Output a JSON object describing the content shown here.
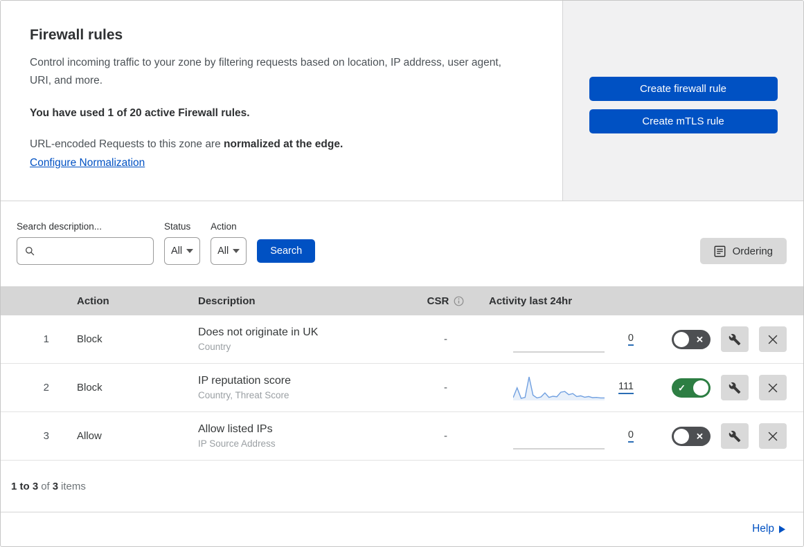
{
  "header": {
    "title": "Firewall rules",
    "description": "Control incoming traffic to your zone by filtering requests based on location, IP address, user agent, URI, and more.",
    "usage_text": "You have used 1 of 20 active Firewall rules.",
    "normalization_text": "URL-encoded Requests to this zone are",
    "normalization_bold": "normalized at the edge.",
    "normalization_link": "Configure Normalization",
    "buttons": {
      "create_firewall": "Create firewall rule",
      "create_mtls": "Create mTLS rule"
    }
  },
  "filters": {
    "search_label": "Search description...",
    "status_label": "Status",
    "status_value": "All",
    "action_label": "Action",
    "action_value": "All",
    "search_button": "Search",
    "ordering_button": "Ordering"
  },
  "table": {
    "columns": {
      "action": "Action",
      "description": "Description",
      "csr": "CSR",
      "activity": "Activity last 24hr"
    },
    "rules": [
      {
        "priority": "1",
        "action": "Block",
        "description": "Does not originate in UK",
        "fields": "Country",
        "csr": "-",
        "activity_count": "0",
        "enabled": false,
        "sparkline": []
      },
      {
        "priority": "2",
        "action": "Block",
        "description": "IP reputation score",
        "fields": "Country, Threat Score",
        "csr": "-",
        "activity_count": "111",
        "enabled": true,
        "sparkline": [
          9,
          52,
          6,
          10,
          100,
          20,
          8,
          12,
          30,
          10,
          15,
          13,
          33,
          36,
          22,
          27,
          14,
          17,
          11,
          14,
          9,
          10,
          8,
          8
        ]
      },
      {
        "priority": "3",
        "action": "Allow",
        "description": "Allow listed IPs",
        "fields": "IP Source Address",
        "csr": "-",
        "activity_count": "0",
        "enabled": false,
        "sparkline": []
      }
    ]
  },
  "footer": {
    "range_bold": "1 to 3",
    "of_text": "of",
    "total_bold": "3",
    "items_text": "items",
    "help_label": "Help"
  },
  "toggle_marks": {
    "on": "✓",
    "off": "✕"
  },
  "colors": {
    "accent_blue": "#0051c3",
    "toggle_on_green": "#2d7e43",
    "toggle_off_gray": "#4d4f52",
    "sparkline_blue": "#6f9fe0",
    "flat_line_gray": "#b9b9b9",
    "table_header_bg": "#d6d6d6",
    "gray_button_bg": "#d9d9d9"
  }
}
